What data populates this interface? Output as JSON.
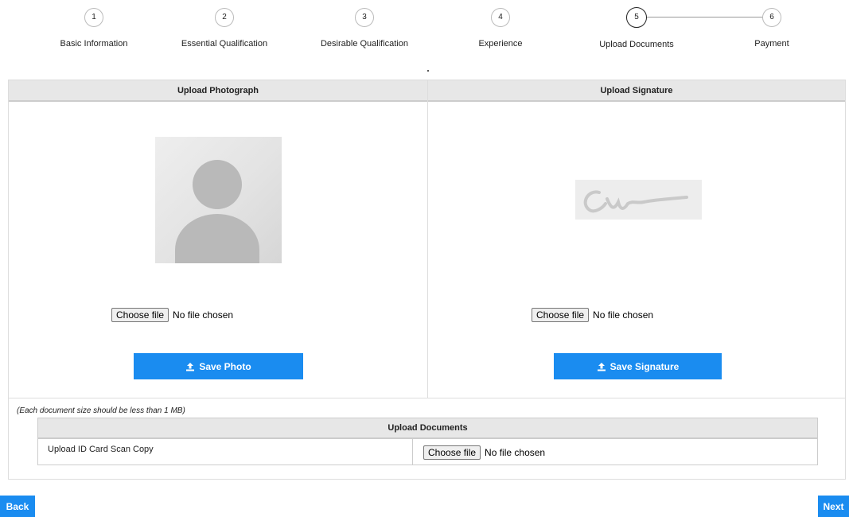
{
  "stepper": {
    "steps": [
      {
        "num": "1",
        "label": "Basic Information"
      },
      {
        "num": "2",
        "label": "Essential Qualification"
      },
      {
        "num": "3",
        "label": "Desirable Qualification"
      },
      {
        "num": "4",
        "label": "Experience"
      },
      {
        "num": "5",
        "label": "Upload Documents"
      },
      {
        "num": "6",
        "label": "Payment"
      }
    ],
    "active_step": 5
  },
  "photo": {
    "header": "Upload Photograph",
    "choose_label": "Choose file",
    "no_file": "No file chosen",
    "save_label": "Save Photo"
  },
  "signature": {
    "header": "Upload Signature",
    "choose_label": "Choose file",
    "no_file": "No file chosen",
    "save_label": "Save Signature"
  },
  "documents": {
    "note": "(Each document size should be less than 1 MB)",
    "header": "Upload Documents",
    "rows": [
      {
        "label": "Upload ID Card Scan Copy",
        "choose_label": "Choose file",
        "no_file": "No file chosen"
      }
    ]
  },
  "nav": {
    "back_label": "Back",
    "next_label": "Next"
  },
  "colors": {
    "primary": "#1a8cf0",
    "header_bg": "#e7e7e7"
  },
  "icons": {
    "upload": "upload-icon",
    "avatar": "avatar-placeholder-icon",
    "signature": "signature-placeholder-icon"
  }
}
